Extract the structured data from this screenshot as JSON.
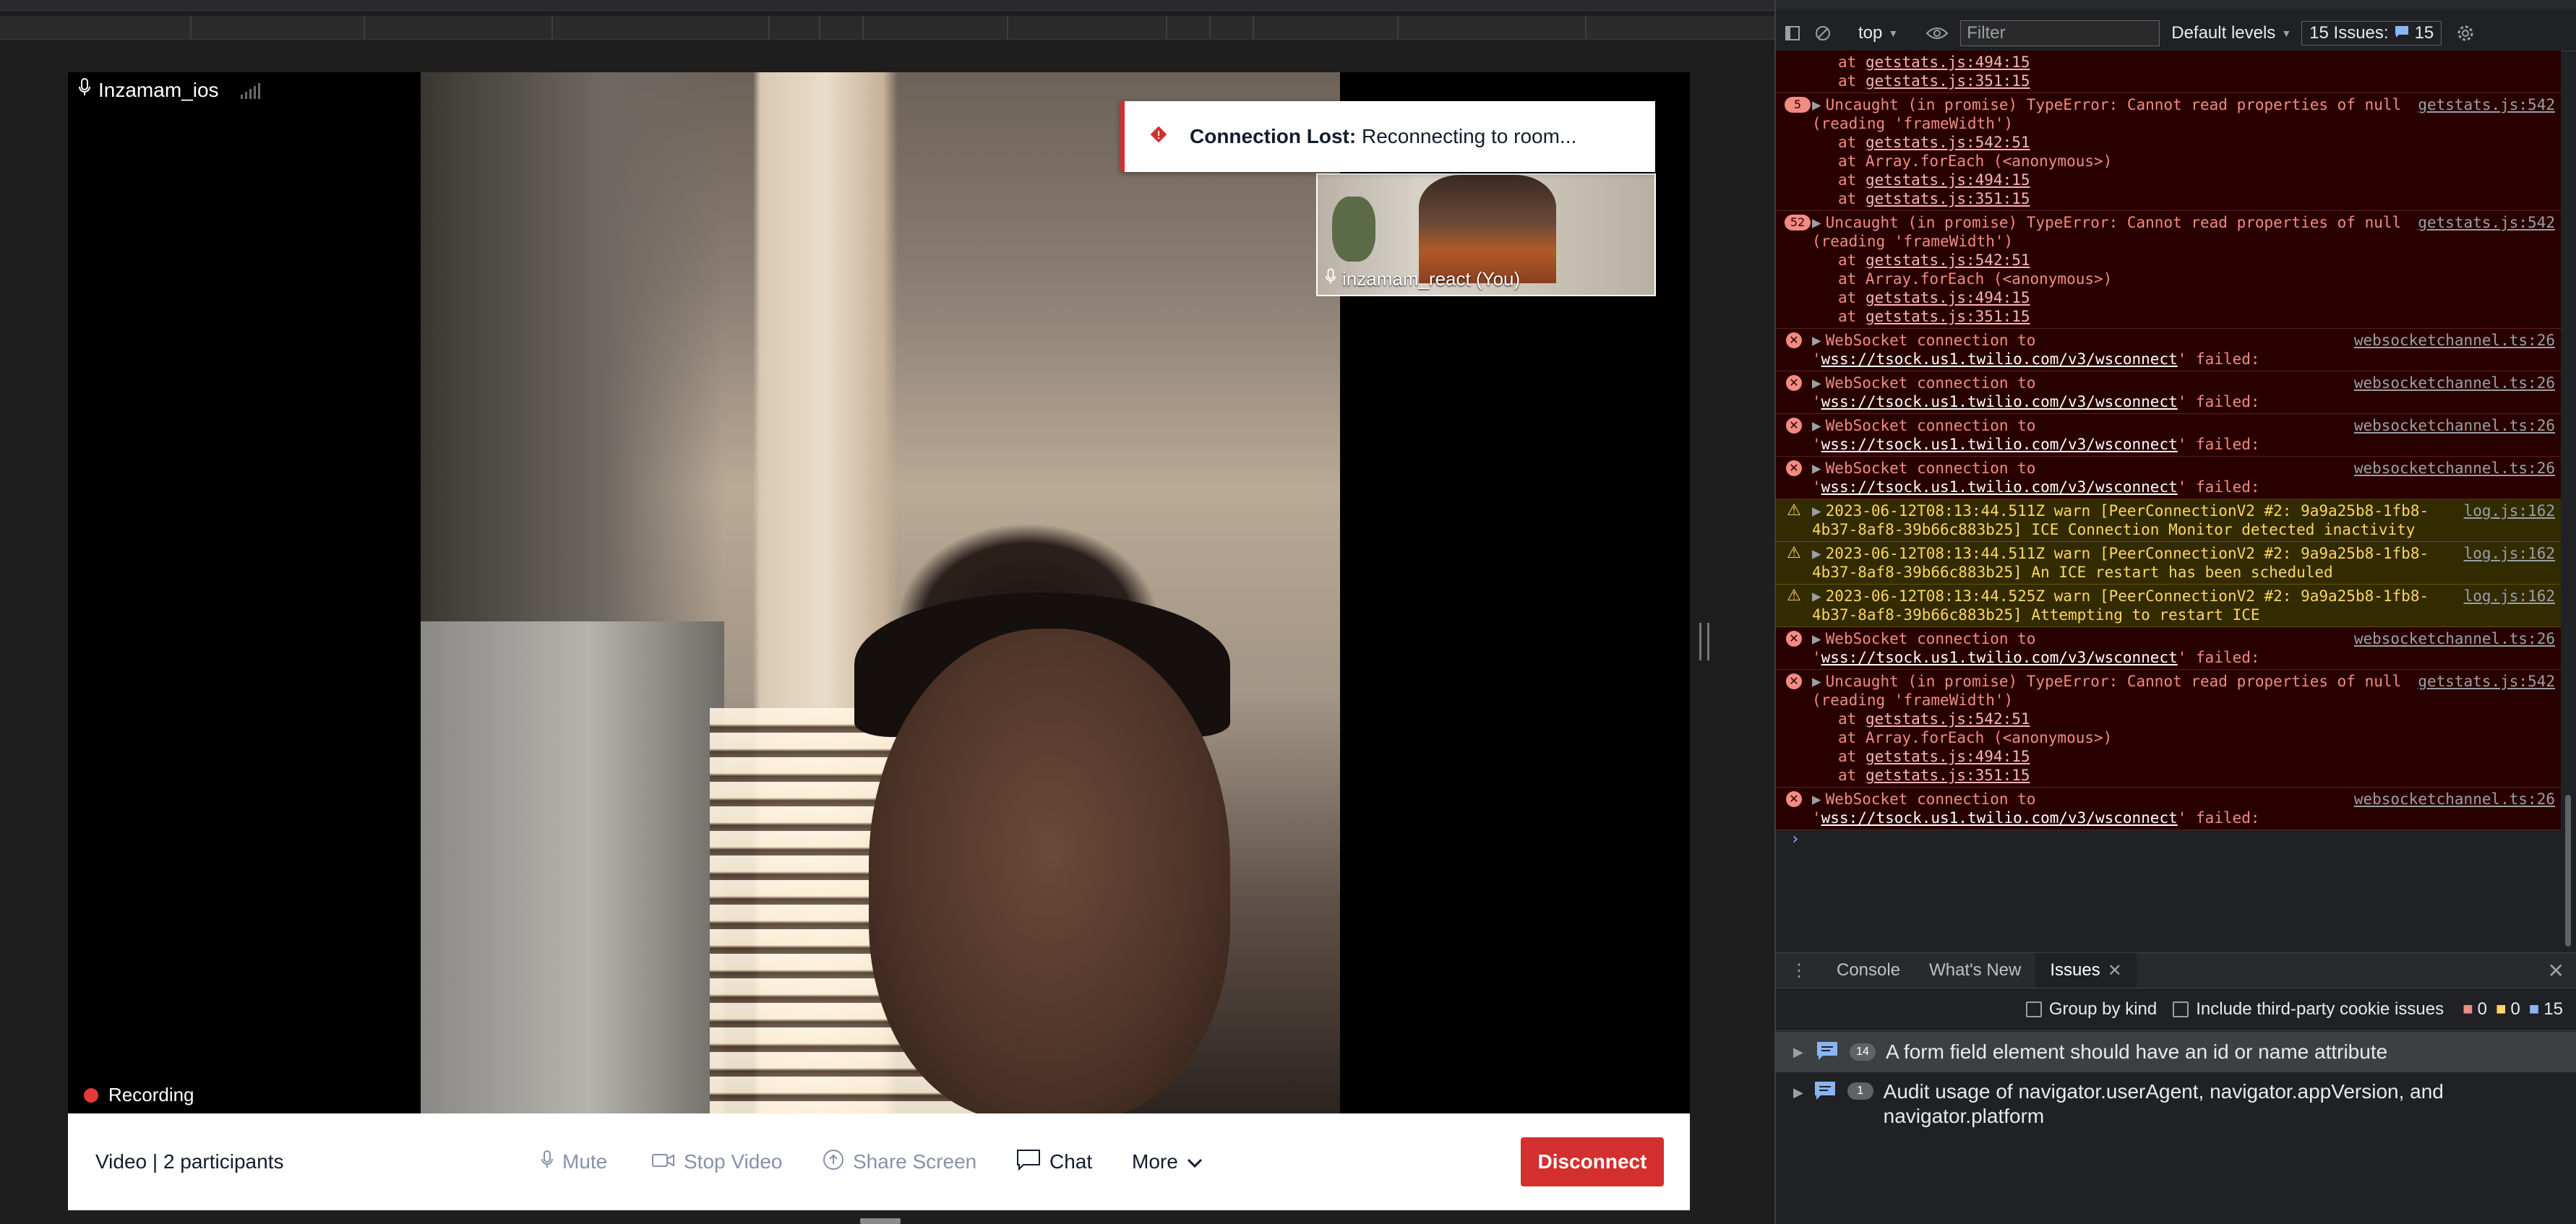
{
  "video_app": {
    "remote_participant": "Inzamam_ios",
    "toast": {
      "title": "Connection Lost:",
      "message": "Reconnecting to room..."
    },
    "local_participant": "inzamam_react (You)",
    "recording_label": "Recording",
    "room_info": "Video | 2 participants",
    "controls": {
      "mute": "Mute",
      "stop_video": "Stop Video",
      "share_screen": "Share Screen",
      "chat": "Chat",
      "more": "More",
      "disconnect": "Disconnect"
    }
  },
  "devtools": {
    "context": "top",
    "filter_placeholder": "Filter",
    "levels": "Default levels",
    "issues_label": "15 Issues:",
    "issues_count": "15",
    "prompt": "›",
    "drawer_tabs": [
      "Console",
      "What's New",
      "Issues"
    ],
    "group_by_kind": "Group by kind",
    "third_party": "Include third-party cookie issues",
    "counts": {
      "errors": "0",
      "warnings": "0",
      "infos": "15"
    },
    "issues": [
      {
        "count": "14",
        "text": "A form field element should have an id or name attribute"
      },
      {
        "count": "1",
        "text": "Audit usage of navigator.userAgent, navigator.appVersion, and navigator.platform"
      }
    ]
  },
  "console_messages": [
    {
      "level": "error",
      "count": "",
      "text": "",
      "source": "",
      "stack": [
        {
          "prefix": "at ",
          "link": "getstats.js:494:15",
          "suffix": ""
        },
        {
          "prefix": "at ",
          "link": "getstats.js:351:15",
          "suffix": ""
        }
      ]
    },
    {
      "level": "error",
      "count": "5",
      "text": "Uncaught (in promise) TypeError: Cannot read properties of null (reading 'frameWidth')",
      "source": "getstats.js:542",
      "stack": [
        {
          "prefix": "at ",
          "link": "getstats.js:542:51",
          "suffix": ""
        },
        {
          "prefix": "at Array.forEach (<anonymous>)",
          "link": "",
          "suffix": ""
        },
        {
          "prefix": "at ",
          "link": "getstats.js:494:15",
          "suffix": ""
        },
        {
          "prefix": "at ",
          "link": "getstats.js:351:15",
          "suffix": ""
        }
      ]
    },
    {
      "level": "error",
      "count": "52",
      "text": "Uncaught (in promise) TypeError: Cannot read properties of null (reading 'frameWidth')",
      "source": "getstats.js:542",
      "stack": [
        {
          "prefix": "at ",
          "link": "getstats.js:542:51",
          "suffix": ""
        },
        {
          "prefix": "at Array.forEach (<anonymous>)",
          "link": "",
          "suffix": ""
        },
        {
          "prefix": "at ",
          "link": "getstats.js:494:15",
          "suffix": ""
        },
        {
          "prefix": "at ",
          "link": "getstats.js:351:15",
          "suffix": ""
        }
      ]
    },
    {
      "level": "error",
      "count": "",
      "text": "WebSocket connection to 'wss://tsock.us1.twilio.com/v3/wsconnect' failed:",
      "source": "websocketchannel.ts:26",
      "stack": []
    },
    {
      "level": "error",
      "count": "",
      "text": "WebSocket connection to 'wss://tsock.us1.twilio.com/v3/wsconnect' failed:",
      "source": "websocketchannel.ts:26",
      "stack": []
    },
    {
      "level": "error",
      "count": "",
      "text": "WebSocket connection to 'wss://tsock.us1.twilio.com/v3/wsconnect' failed:",
      "source": "websocketchannel.ts:26",
      "stack": []
    },
    {
      "level": "error",
      "count": "",
      "text": "WebSocket connection to 'wss://tsock.us1.twilio.com/v3/wsconnect' failed:",
      "source": "websocketchannel.ts:26",
      "stack": []
    },
    {
      "level": "warn",
      "count": "",
      "text": "2023-06-12T08:13:44.511Z warn [PeerConnectionV2 #2: 9a9a25b8-1fb8-4b37-8af8-39b66c883b25] ICE Connection Monitor detected inactivity",
      "source": "log.js:162",
      "stack": []
    },
    {
      "level": "warn",
      "count": "",
      "text": "2023-06-12T08:13:44.511Z warn [PeerConnectionV2 #2: 9a9a25b8-1fb8-4b37-8af8-39b66c883b25] An ICE restart has been scheduled",
      "source": "log.js:162",
      "stack": []
    },
    {
      "level": "warn",
      "count": "",
      "text": "2023-06-12T08:13:44.525Z warn [PeerConnectionV2 #2: 9a9a25b8-1fb8-4b37-8af8-39b66c883b25] Attempting to restart ICE",
      "source": "log.js:162",
      "stack": []
    },
    {
      "level": "error",
      "count": "",
      "text": "WebSocket connection to 'wss://tsock.us1.twilio.com/v3/wsconnect' failed:",
      "source": "websocketchannel.ts:26",
      "stack": []
    },
    {
      "level": "error",
      "count": "",
      "text": "Uncaught (in promise) TypeError: Cannot read properties of null (reading 'frameWidth')",
      "source": "getstats.js:542",
      "stack": [
        {
          "prefix": "at ",
          "link": "getstats.js:542:51",
          "suffix": ""
        },
        {
          "prefix": "at Array.forEach (<anonymous>)",
          "link": "",
          "suffix": ""
        },
        {
          "prefix": "at ",
          "link": "getstats.js:494:15",
          "suffix": ""
        },
        {
          "prefix": "at ",
          "link": "getstats.js:351:15",
          "suffix": ""
        }
      ]
    },
    {
      "level": "error",
      "count": "",
      "text": "WebSocket connection to 'wss://tsock.us1.twilio.com/v3/wsconnect' failed:",
      "source": "websocketchannel.ts:26",
      "stack": []
    }
  ],
  "colors": {
    "error_bg": "#290000",
    "warn_bg": "#332b00",
    "disconnect": "#d32f2f",
    "link_blue": "#8ab4f8"
  },
  "icons": [
    "mic-icon",
    "signal-icon",
    "warning-icon",
    "record-icon",
    "camera-icon",
    "share-icon",
    "chat-icon",
    "chevron-down-icon",
    "dock-icon",
    "clear-icon",
    "eye-icon",
    "gear-icon",
    "close-icon",
    "kebab-icon",
    "issue-icon"
  ]
}
